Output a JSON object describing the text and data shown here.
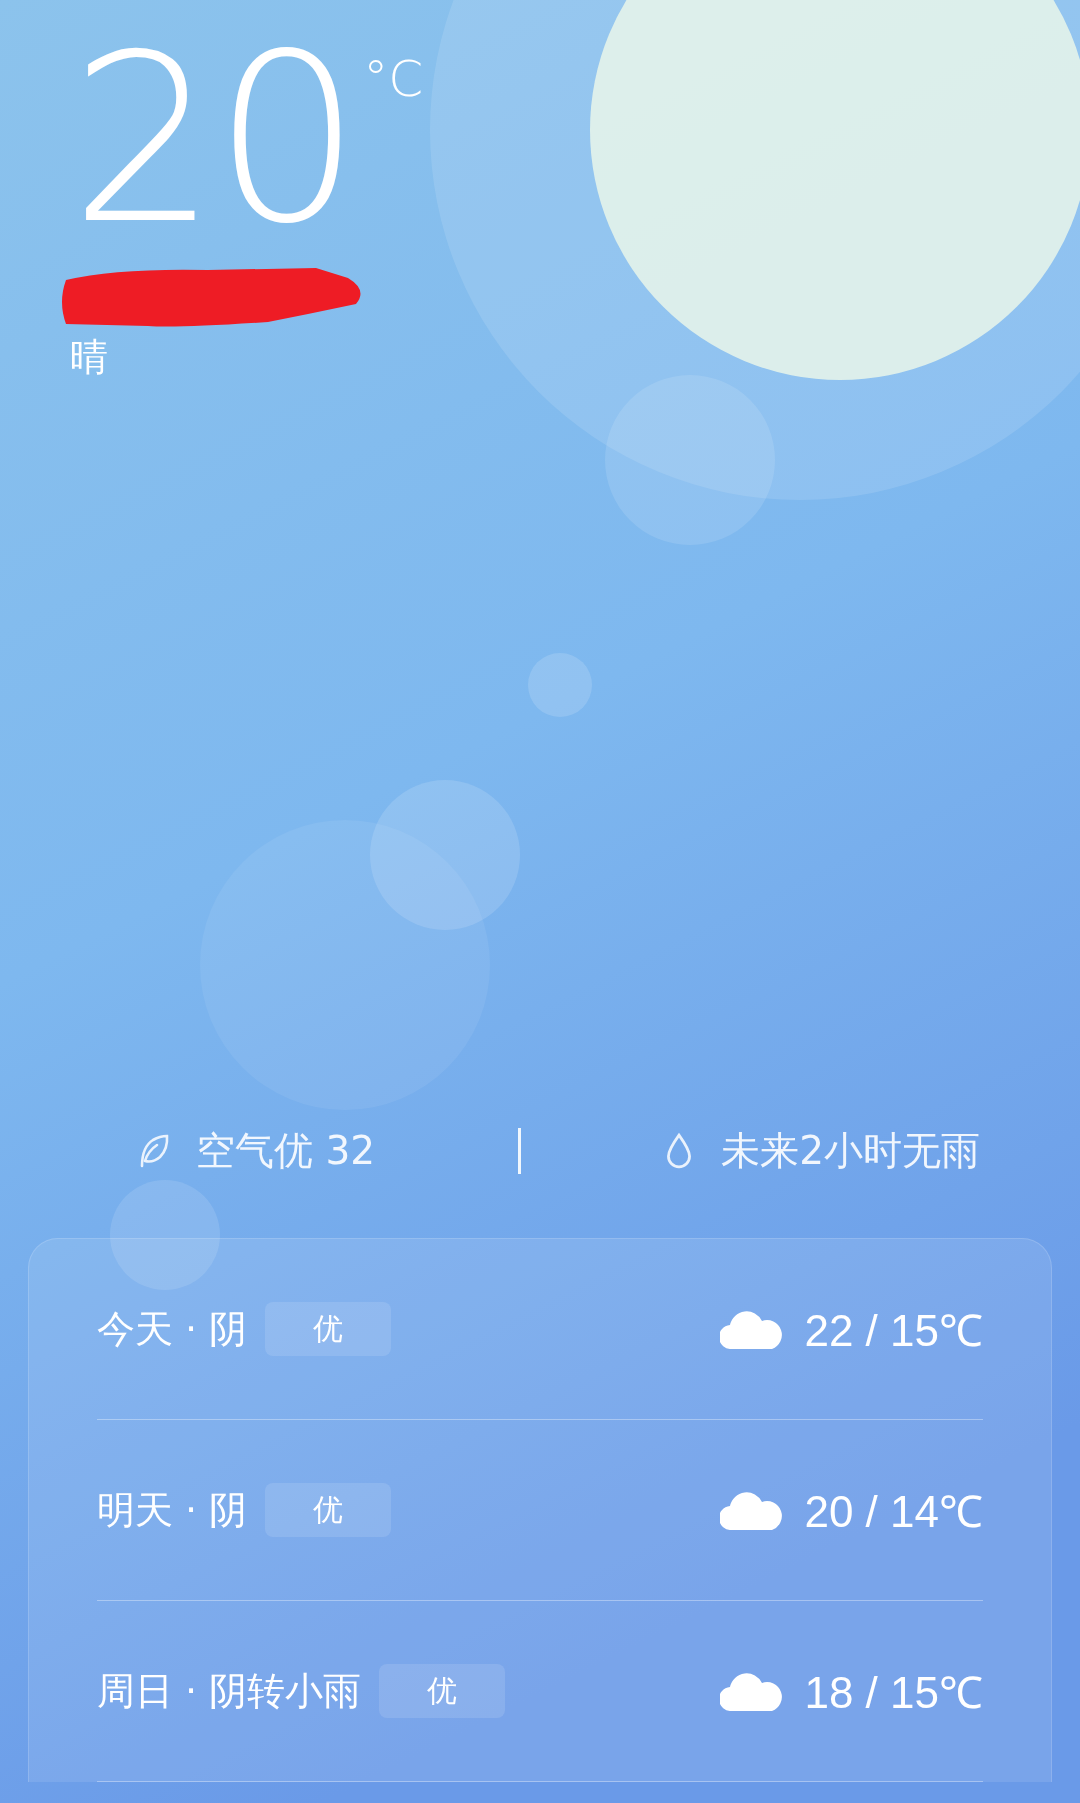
{
  "current": {
    "temperature": "20",
    "unit": "°C",
    "condition": "晴"
  },
  "summary": {
    "air_quality": "空气优 32",
    "rain": "未来2小时无雨"
  },
  "forecast": [
    {
      "day_weather": "今天 · 阴",
      "aqi": "优",
      "kind": "cloudy",
      "temps": "22 / 15℃"
    },
    {
      "day_weather": "明天 · 阴",
      "aqi": "优",
      "kind": "cloudy",
      "temps": "20 / 14℃"
    },
    {
      "day_weather": "周日 · 阴转小雨",
      "aqi": "优",
      "kind": "cloudy",
      "temps": "18 / 15℃"
    }
  ]
}
